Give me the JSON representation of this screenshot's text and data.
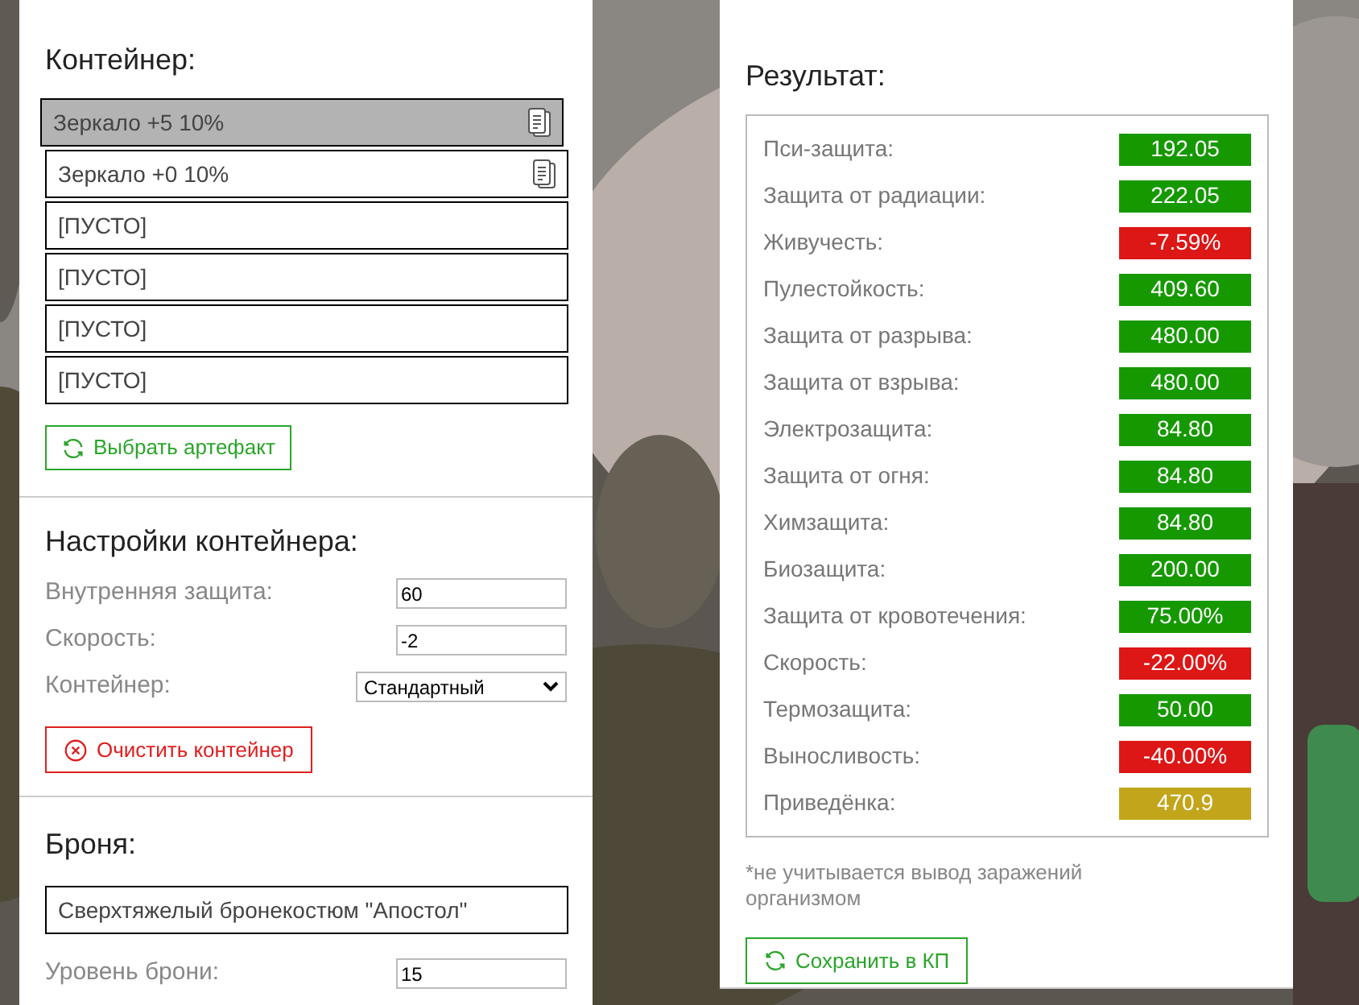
{
  "container": {
    "title": "Контейнер:",
    "slots": [
      {
        "text": "Зеркало +5 10%",
        "kind": "artifact",
        "selected": true
      },
      {
        "text": "Зеркало +0 10%",
        "kind": "artifact",
        "selected": false
      },
      {
        "text": "[ПУСТО]",
        "kind": "empty",
        "selected": false
      },
      {
        "text": "[ПУСТО]",
        "kind": "empty",
        "selected": false
      },
      {
        "text": "[ПУСТО]",
        "kind": "empty",
        "selected": false
      },
      {
        "text": "[ПУСТО]",
        "kind": "empty",
        "selected": false
      }
    ],
    "button": "Выбрать артефакт"
  },
  "settings": {
    "title": "Настройки контейнера:",
    "fields": [
      {
        "label": "Внутренняя защита:",
        "kind": "input",
        "value": "60"
      },
      {
        "label": "Скорость:",
        "kind": "input",
        "value": "-2"
      },
      {
        "label": "Контейнер:",
        "kind": "select",
        "value": "Стандартный"
      }
    ],
    "button": "Очистить контейнер"
  },
  "armor": {
    "title": "Броня:",
    "name": "Сверхтяжелый бронекостюм \"Апостол\"",
    "level_label": "Уровень брони:",
    "level_value": "15"
  },
  "result": {
    "title": "Результат:",
    "rows": [
      {
        "label": "Пси-защита:",
        "value": "192.05",
        "color": "#169900"
      },
      {
        "label": "Защита от радиации:",
        "value": "222.05",
        "color": "#169900"
      },
      {
        "label": "Живучесть:",
        "value": "-7.59%",
        "color": "#dd1616"
      },
      {
        "label": "Пулестойкость:",
        "value": "409.60",
        "color": "#169900"
      },
      {
        "label": "Защита от разрыва:",
        "value": "480.00",
        "color": "#169900"
      },
      {
        "label": "Защита от взрыва:",
        "value": "480.00",
        "color": "#169900"
      },
      {
        "label": "Электрозащита:",
        "value": "84.80",
        "color": "#169900"
      },
      {
        "label": "Защита от огня:",
        "value": "84.80",
        "color": "#169900"
      },
      {
        "label": "Химзащита:",
        "value": "84.80",
        "color": "#169900"
      },
      {
        "label": "Биозащита:",
        "value": "200.00",
        "color": "#169900"
      },
      {
        "label": "Защита от кровотечения:",
        "value": "75.00%",
        "color": "#169900"
      },
      {
        "label": "Скорость:",
        "value": "-22.00%",
        "color": "#dd1616"
      },
      {
        "label": "Термозащита:",
        "value": "50.00",
        "color": "#169900"
      },
      {
        "label": "Выносливость:",
        "value": "-40.00%",
        "color": "#dd1616"
      },
      {
        "label": "Приведёнка:",
        "value": "470.9",
        "color": "#c3a51b"
      }
    ],
    "note": "*не учитывается вывод заражений организмом",
    "button": "Сохранить в КП"
  }
}
